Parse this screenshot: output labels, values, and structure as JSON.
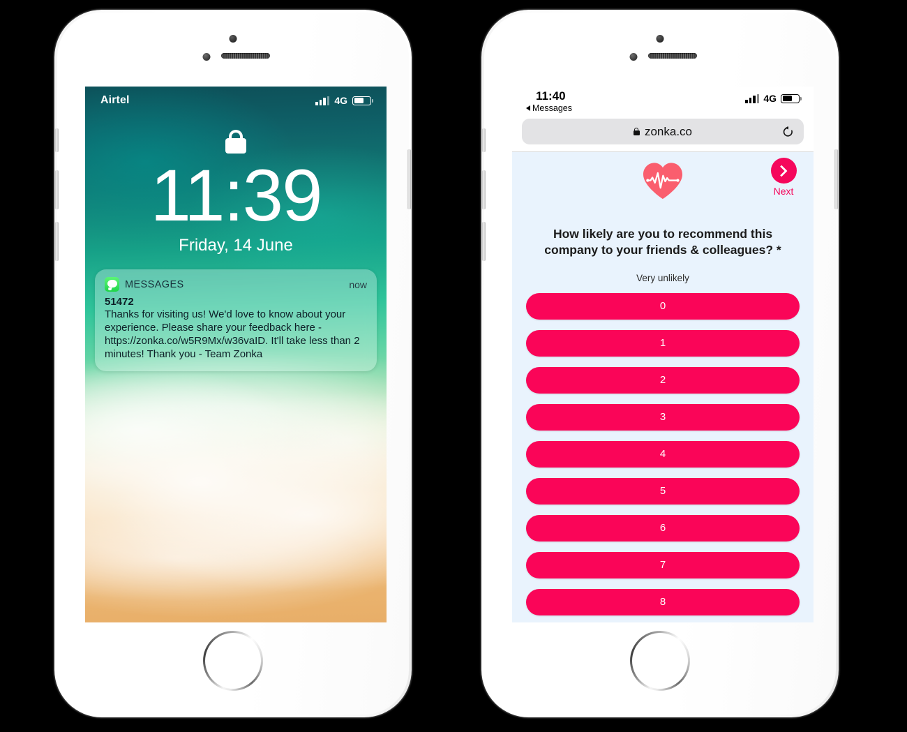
{
  "left_phone": {
    "device": "iphone-white",
    "lock_screen": {
      "status_bar": {
        "carrier": "Airtel",
        "network": "4G",
        "signal_bars": 4,
        "signal_bars_filled": 3,
        "battery_percent": 55
      },
      "lock_icon": "lock-icon",
      "time": "11:39",
      "date": "Friday, 14 June",
      "notification": {
        "app_icon": "messages-app-icon",
        "app_name": "MESSAGES",
        "timestamp": "now",
        "sender": "51472",
        "body": "Thanks for visiting us! We'd love to know about your experience. Please share your feedback here - https://zonka.co/w5R9Mx/w36vaID. It'll take less than 2 minutes! Thank you - Team Zonka"
      }
    }
  },
  "right_phone": {
    "device": "iphone-white",
    "browser": {
      "status_bar": {
        "clock": "11:40",
        "back_label": "Messages",
        "network": "4G",
        "signal_bars": 4,
        "battery_percent": 55
      },
      "url_bar": {
        "lock_icon": "lock-icon",
        "url": "zonka.co",
        "reload_icon": "reload-icon"
      }
    },
    "survey": {
      "logo": "heart-pulse-icon",
      "next_button": {
        "label": "Next",
        "icon": "chevron-right-icon"
      },
      "question": "How likely are you to recommend this company to your friends & colleagues? *",
      "scale_low_label": "Very unlikely",
      "rating_options": [
        "0",
        "1",
        "2",
        "3",
        "4",
        "5",
        "6",
        "7",
        "8"
      ]
    }
  },
  "colors": {
    "background": "#000000",
    "survey_background": "#E9F3FD",
    "accent_pink": "#FA0558",
    "next_pink": "#F5075C",
    "heart_coral": "#FA5E6E",
    "url_bar_gray": "#E3E3E5"
  }
}
